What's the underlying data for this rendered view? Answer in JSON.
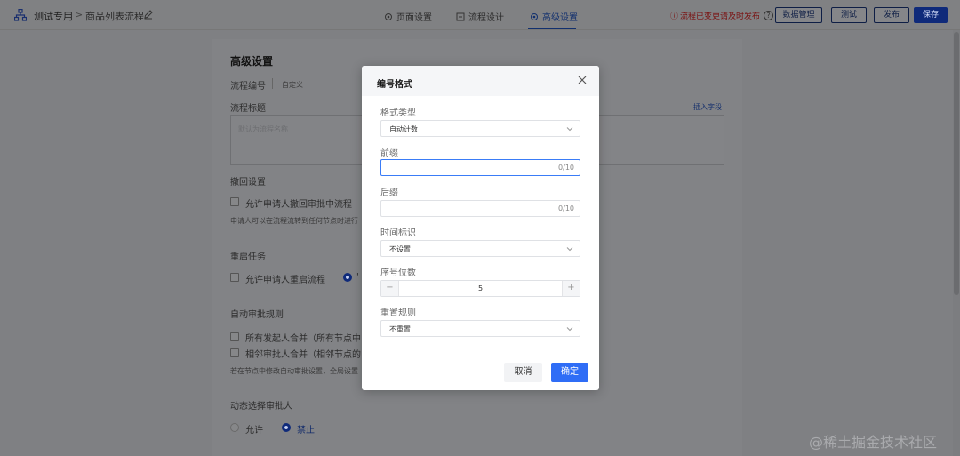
{
  "header": {
    "app_name": "测试专用",
    "separator": ">",
    "flow_name": "商品列表流程",
    "tabs": [
      {
        "label": "页面设置",
        "icon": "gear-icon"
      },
      {
        "label": "流程设计",
        "icon": "flow-icon"
      },
      {
        "label": "高级设置",
        "icon": "gear-icon",
        "active": true
      }
    ],
    "warning": "流程已变更请及时发布",
    "buttons": {
      "data_manage": "数据管理",
      "test": "测试",
      "publish": "发布",
      "save": "保存"
    },
    "accent_color": "#0f2a7a"
  },
  "panel": {
    "title": "高级设置",
    "flow_number_label": "流程编号",
    "flow_number_value": "自定义",
    "flow_title_label": "流程标题",
    "insert_field": "插入字段",
    "flow_title_placeholder": "默认为流程名称",
    "withdraw_label": "撤回设置",
    "withdraw_option": "允许申请人撤回审批中流程",
    "withdraw_hint": "申请人可以在流程流转到任何节点时进行",
    "restart_label": "重启任务",
    "restart_option": "允许申请人重启流程",
    "restart_radio_text": "'",
    "auto_label": "自动审批规则",
    "auto_option1": "所有发起人合并（所有节点中",
    "auto_option2": "相邻审批人合并（相邻节点的",
    "auto_hint": "若在节点中修改自动审批设置，全局设置",
    "dynamic_label": "动态选择审批人",
    "dynamic_allow": "允许",
    "dynamic_forbid": "禁止"
  },
  "modal": {
    "title": "编号格式",
    "format_type_label": "格式类型",
    "format_type_value": "自动计数",
    "prefix_label": "前缀",
    "prefix_counter": "0/10",
    "suffix_label": "后缀",
    "suffix_counter": "0/10",
    "time_label": "时间标识",
    "time_value": "不设置",
    "serial_label": "序号位数",
    "serial_minus": "−",
    "serial_value": "5",
    "serial_plus": "+",
    "reset_label": "重置规则",
    "reset_value": "不重置",
    "cancel": "取消",
    "confirm": "确定",
    "primary_color": "#2f6df6"
  },
  "watermark": "@稀土掘金技术社区"
}
